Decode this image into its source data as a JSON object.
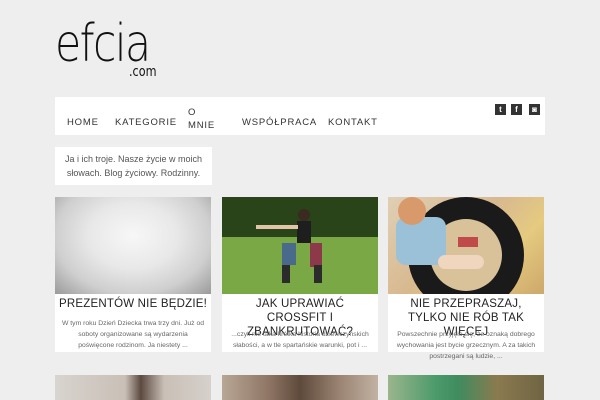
{
  "logo": {
    "main": "efcia",
    "sub": ".com"
  },
  "nav": {
    "home": "HOME",
    "kategorie": "KATEGORIE",
    "o_mnie_line1": "O",
    "o_mnie_line2": "MNIE",
    "wspolpraca": "WSPÓŁPRACA",
    "kontakt": "KONTAKT"
  },
  "social": {
    "twitter": "t",
    "facebook": "f",
    "instagram": "◙"
  },
  "tagline": "Ja i ich troje. Nasze życie w moich słowach. Blog życiowy. Rodzinny.",
  "posts": [
    {
      "title": "PREZENTÓW NIE BĘDZIE!",
      "excerpt": "W tym roku Dzień Dziecka trwa trzy dni. Już od soboty organizowane są wydarzenia poświęcone rodzinom. Ja niestety ..."
    },
    {
      "title": "JAK UPRAWIAĆ CROSSFIT I ZBANKRUTOWAĆ?",
      "excerpt": "...czyli nie taka krótka historia dziewczyńskich słabości, a w tle spartańskie warunki, pot i ..."
    },
    {
      "title": "NIE PRZEPRASZAJ, TYLKO NIE RÓB TAK WIĘCEJ",
      "excerpt": "Powszechnie przyjęło się, że oznaką dobrego wychowania jest bycie grzecznym. A za takich postrzegani są ludzie, ..."
    }
  ]
}
